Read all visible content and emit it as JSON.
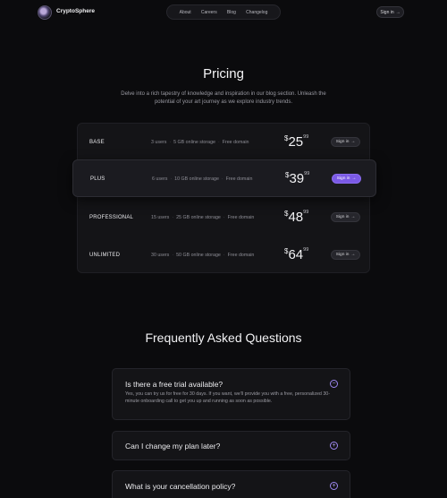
{
  "header": {
    "brand": "CryptoSphere",
    "nav": [
      "About",
      "Careers",
      "Blog",
      "Changelog"
    ],
    "signin": "Sign in",
    "signin_arrow": "→"
  },
  "hero": {
    "title": "Pricing",
    "subtitle": "Delve into a rich tapestry of knowledge and inspiration in our blog section. Unleash the potential of your art journey as we explore industry trends."
  },
  "plans": [
    {
      "name": "BASE",
      "users": "3 users",
      "storage": "5 GB online storage",
      "domain": "Free domain",
      "currency": "$",
      "price": "25",
      "cents": "99",
      "button": "Sign in",
      "highlighted": false
    },
    {
      "name": "PLUS",
      "users": "6 users",
      "storage": "10 GB online storage",
      "domain": "Free domain",
      "currency": "$",
      "price": "39",
      "cents": "99",
      "button": "Sign in",
      "highlighted": true
    },
    {
      "name": "PROFESSIONAL",
      "users": "15 users",
      "storage": "25 GB online storage",
      "domain": "Free domain",
      "currency": "$",
      "price": "48",
      "cents": "99",
      "button": "Sign in",
      "highlighted": false
    },
    {
      "name": "UNLIMITED",
      "users": "30 users",
      "storage": "50 GB online storage",
      "domain": "Free domain",
      "currency": "$",
      "price": "64",
      "cents": "99",
      "button": "Sign in",
      "highlighted": false
    }
  ],
  "plan_button_arrow": "→",
  "feature_separator": "·",
  "faq": {
    "title": "Frequently Asked Questions",
    "items": [
      {
        "question": "Is there a free trial available?",
        "answer": "Yes, you can try us for free for 30 days. If you want, we'll provide you with a free, personalized 30-minute onboarding call to get you up and running as soon as possible.",
        "expanded": true,
        "icon": "minus-circle-icon",
        "symbol": "−"
      },
      {
        "question": "Can I change my plan later?",
        "expanded": false,
        "icon": "plus-circle-icon",
        "symbol": "+"
      },
      {
        "question": "What is your cancellation policy?",
        "expanded": false,
        "icon": "plus-circle-icon",
        "symbol": "+"
      }
    ]
  },
  "colors": {
    "background": "#0b0b0d",
    "accent": "#7b5ae6",
    "icon_accent": "#9d86f0"
  }
}
